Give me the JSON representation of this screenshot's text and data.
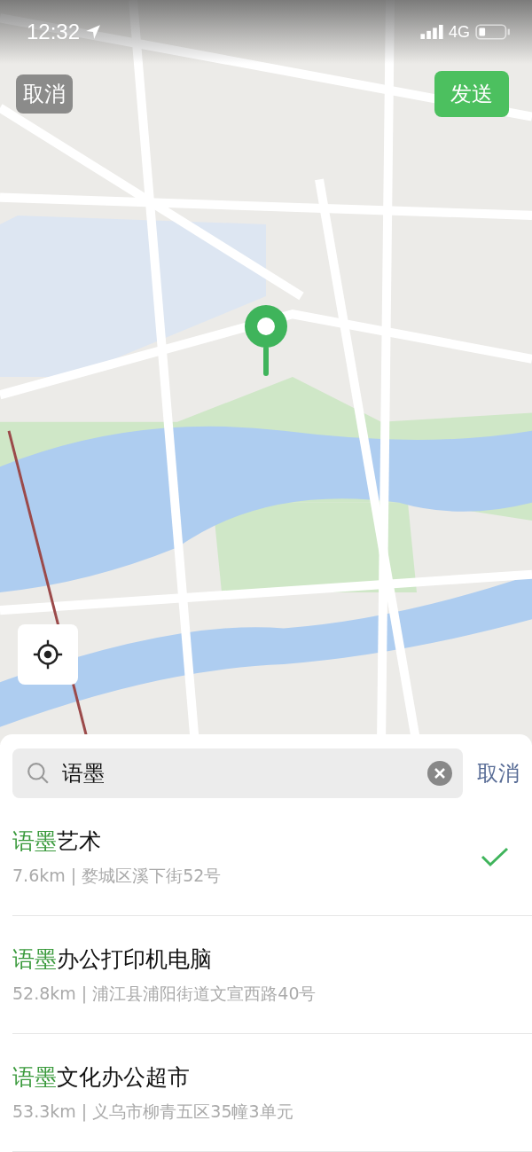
{
  "status_bar": {
    "time": "12:32",
    "network": "4G"
  },
  "header": {
    "cancel": "取消",
    "send": "发送"
  },
  "search": {
    "value": "语墨",
    "cancel": "取消"
  },
  "results": [
    {
      "match": "语墨",
      "rest": "艺术",
      "detail": "7.6km | 婺城区溪下街52号",
      "selected": true
    },
    {
      "match": "语墨",
      "rest": "办公打印机电脑",
      "detail": "52.8km | 浦江县浦阳街道文宣西路40号",
      "selected": false
    },
    {
      "match": "语墨",
      "rest": "文化办公超市",
      "detail": "53.3km | 义乌市柳青五区35幢3单元",
      "selected": false
    }
  ]
}
